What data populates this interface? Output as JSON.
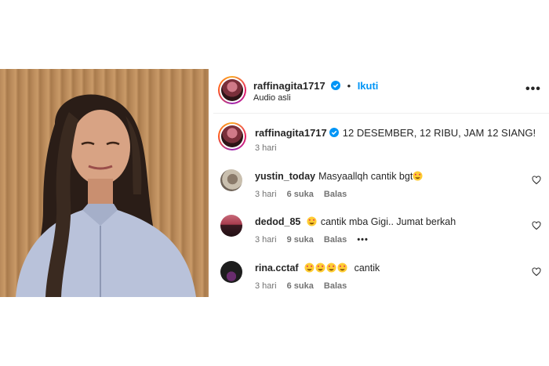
{
  "post": {
    "author": "raffinagita1717",
    "follow_label": "Ikuti",
    "separator": "•",
    "audio_label": "Audio asli",
    "more_label": "•••"
  },
  "caption": {
    "author": "raffinagita1717",
    "text": "12 DESEMBER, 12 RIBU, JAM 12 SIANG!",
    "time": "3 hari"
  },
  "comments": [
    {
      "user": "yustin_today",
      "text": "Masyaallqh cantik bgt",
      "emoji_after": 1,
      "time": "3 hari",
      "likes": "6 suka",
      "reply": "Balas"
    },
    {
      "user": "dedod_85",
      "emoji_before": 1,
      "text": "cantik mba Gigi.. Jumat berkah",
      "time": "3 hari",
      "likes": "9 suka",
      "reply": "Balas",
      "more": "•••"
    },
    {
      "user": "rina.cctaf",
      "emoji_before": 4,
      "text": "cantik",
      "time": "3 hari",
      "likes": "6 suka",
      "reply": "Balas"
    }
  ],
  "colors": {
    "link": "#0095f6",
    "verified": "#0095f6",
    "muted": "#737373"
  },
  "icons": [
    "verified-badge-icon",
    "more-options-icon",
    "heart-icon",
    "heart-eyes-emoji"
  ]
}
